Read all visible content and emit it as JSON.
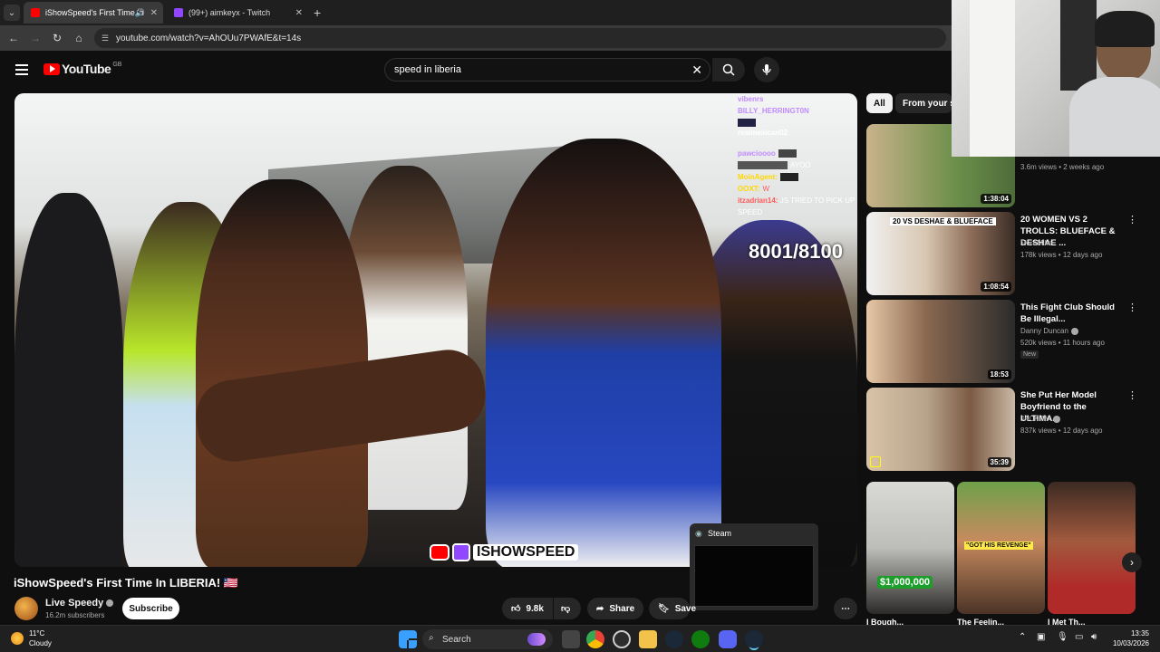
{
  "browser": {
    "tabs": [
      {
        "title": "iShowSpeed's First Time In",
        "active": true,
        "favicon_color": "#ff0000"
      },
      {
        "title": "(99+) aimkeyx - Twitch",
        "active": false,
        "favicon_color": "#9146ff"
      }
    ],
    "new_tab": "+",
    "url": "youtube.com/watch?v=AhOUu7PWAfE&t=14s",
    "icons": [
      "tab-list-icon",
      "audio-icon",
      "close-icon",
      "back-icon",
      "forward-icon",
      "reload-icon",
      "home-icon",
      "site-info-icon"
    ]
  },
  "youtube": {
    "logo_text": "YouTube",
    "region": "GB",
    "search_query": "speed in liberia",
    "accent": "#ff0000"
  },
  "video": {
    "title": "iShowSpeed's First Time In LIBERIA! 🇱🇷",
    "counter": "8001/8100",
    "watermark": "ISHOWSPEED",
    "chat": [
      {
        "name": "vibenrs",
        "msg": "",
        "color": "#c08bff"
      },
      {
        "name": "BILLY_HERRINGT0N",
        "msg": "",
        "color": "#c08bff"
      },
      {
        "name": "",
        "msg": "",
        "color": "#fff"
      },
      {
        "name": "realmexican02",
        "msg": "",
        "color": "#fff"
      },
      {
        "name": "pawcioooo",
        "msg": "",
        "color": "#c08bff"
      },
      {
        "name": "",
        "msg": "AYOO",
        "color": "#9acd32"
      },
      {
        "name": "MoinAgent:",
        "msg": "",
        "color": "#ffd700"
      },
      {
        "name": "OOXT:",
        "msg": "W",
        "color": "#ffd700"
      },
      {
        "name": "itzadrian14:",
        "msg": "JS TRIED TO PICK UP SPEED",
        "color": "#ff5a5a"
      }
    ]
  },
  "channel": {
    "name": "Live Speedy",
    "subscribers": "16.2m subscribers",
    "subscribe_label": "Subscribe"
  },
  "actions": {
    "likes": "9.8k",
    "share": "Share",
    "save": "Save"
  },
  "steam_popup": {
    "title": "Steam"
  },
  "sidebar": {
    "chips": [
      "All",
      "From your se"
    ],
    "recommendations": [
      {
        "title": "",
        "channel": "",
        "meta": "3.6m views • 2 weeks ago",
        "duration": "1:38:04",
        "badge": ""
      },
      {
        "title": "20 WOMEN VS 2 TROLLS: BLUEFACE & DESHAE ...",
        "channel": "MoreMike",
        "meta": "178k views • 12 days ago",
        "duration": "1:08:54",
        "badge": "",
        "thumb_text": "20 VS DESHAE & BLUEFACE"
      },
      {
        "title": "This Fight Club Should Be Illegal...",
        "channel": "Danny Duncan",
        "meta": "520k views • 11 hours ago",
        "duration": "18:53",
        "badge": "New"
      },
      {
        "title": "She Put Her Model Boyfriend to the ULTIMA...",
        "channel": "JACK TV",
        "meta": "837k views • 12 days ago",
        "duration": "35:39",
        "badge": ""
      }
    ],
    "shorts": [
      {
        "overlay": "$1,000,000"
      },
      {
        "overlay": "\"GOT HIS REVENGE\""
      },
      {
        "overlay": ""
      }
    ],
    "shorts_titles_cut": [
      "I Bough...",
      "The Feelin...",
      "I Met Th..."
    ]
  },
  "taskbar": {
    "weather_temp": "11°C",
    "weather_desc": "Cloudy",
    "search_label": "Search",
    "time": "13:35",
    "date": "10/03/2026"
  }
}
